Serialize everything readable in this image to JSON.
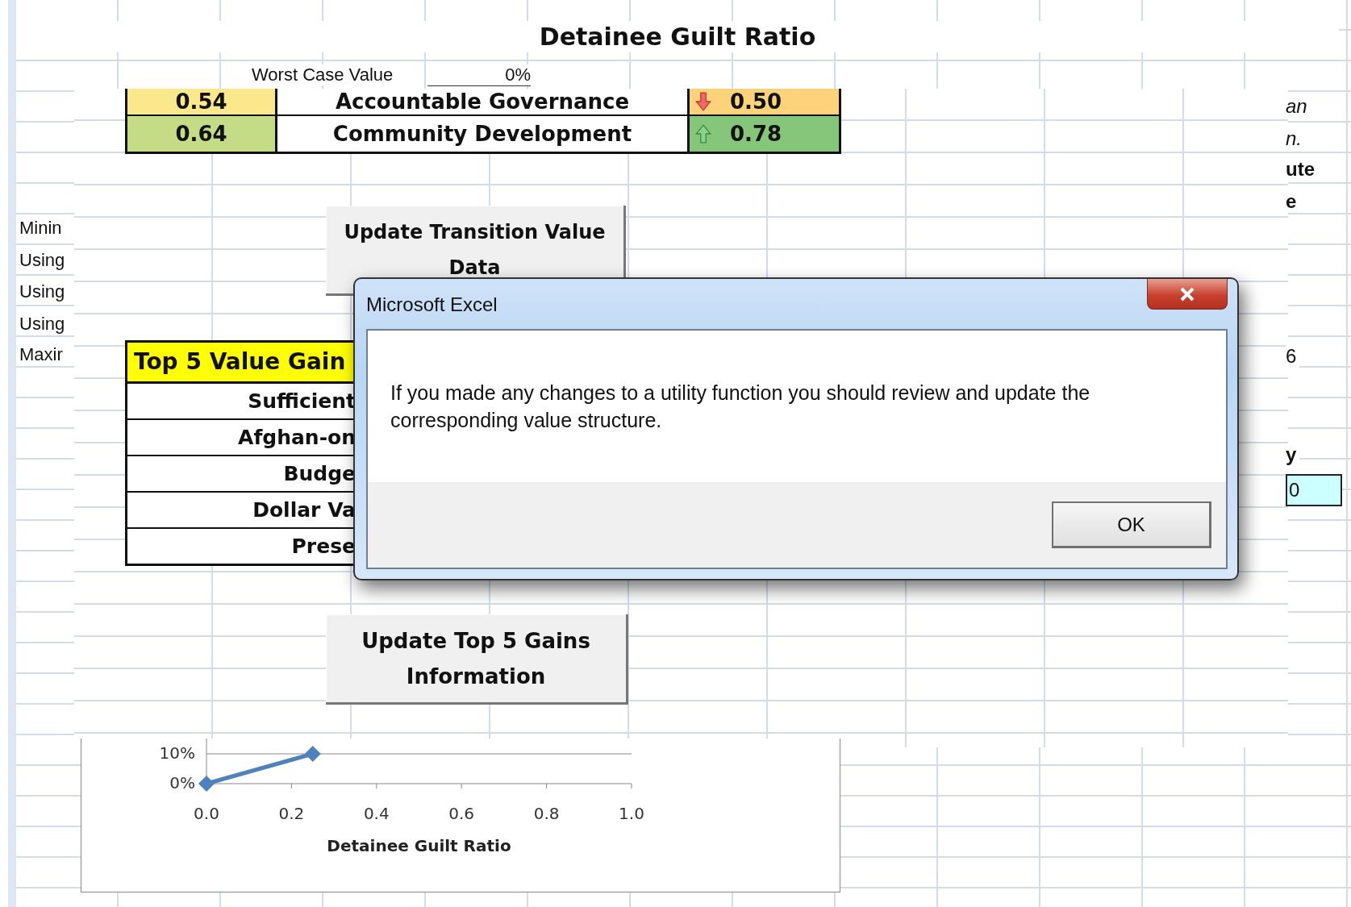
{
  "sheet": {
    "title": "Detainee Guilt Ratio",
    "worst_case_label": "Worst Case Value",
    "worst_case_value": "0%"
  },
  "transition_rows": [
    {
      "name": "Accountable Governance",
      "current": {
        "text": "0.54",
        "color": "#fbe78c"
      },
      "change": {
        "increase": false,
        "text": "0.50",
        "color": "#fcd27a"
      }
    },
    {
      "name": "Community Development",
      "current": {
        "text": "0.64",
        "color": "#c5dc87"
      },
      "change": {
        "increase": true,
        "text": "0.78",
        "color": "#86c67a"
      }
    }
  ],
  "left_labels": [
    "Minin",
    "Using",
    "Using",
    "Using",
    "Maxir"
  ],
  "transition_button": "Update Transition Value Data",
  "top5": {
    "header": "Top 5 Value Gain",
    "rows": [
      "Sufficient",
      "Afghan-on",
      "Budge",
      "Dollar Va",
      "Prese"
    ]
  },
  "gains_button": "Update Top 5 Gains Information",
  "right_fragments": [
    {
      "kind": "italic",
      "text": "an"
    },
    {
      "kind": "italic",
      "text": "n."
    },
    {
      "kind": "bold",
      "text": "ute"
    },
    {
      "kind": "bold",
      "text": "e"
    },
    {
      "kind": "plain",
      "text": "6"
    },
    {
      "kind": "bold",
      "text": "y"
    },
    {
      "kind": "cell",
      "text": "0"
    }
  ],
  "chart": {
    "chart_data": {
      "type": "line",
      "xlabel": "Detainee Guilt Ratio",
      "x": [
        0,
        0.25
      ],
      "series": [
        {
          "color": "#4f81bd",
          "marker": "diamond",
          "values": [
            0,
            0.1
          ]
        }
      ],
      "xlim": [
        0,
        1
      ],
      "ylim": [
        0,
        0.1
      ],
      "xticks": [
        {
          "value": 0,
          "label": "0.0"
        },
        {
          "value": 0.2,
          "label": "0.2"
        },
        {
          "value": 0.4,
          "label": "0.4"
        },
        {
          "value": 0.6,
          "label": "0.6"
        },
        {
          "value": 0.8,
          "label": "0.8"
        },
        {
          "value": 1,
          "label": "1.0"
        }
      ],
      "yticks": [
        {
          "value": 0,
          "label": "0%"
        },
        {
          "value": 0.1,
          "label": "10%"
        }
      ]
    }
  },
  "dialog": {
    "title": "Microsoft Excel",
    "message": "If you made any changes to a utility function you should review and update the corresponding value structure.",
    "button": "OK"
  }
}
